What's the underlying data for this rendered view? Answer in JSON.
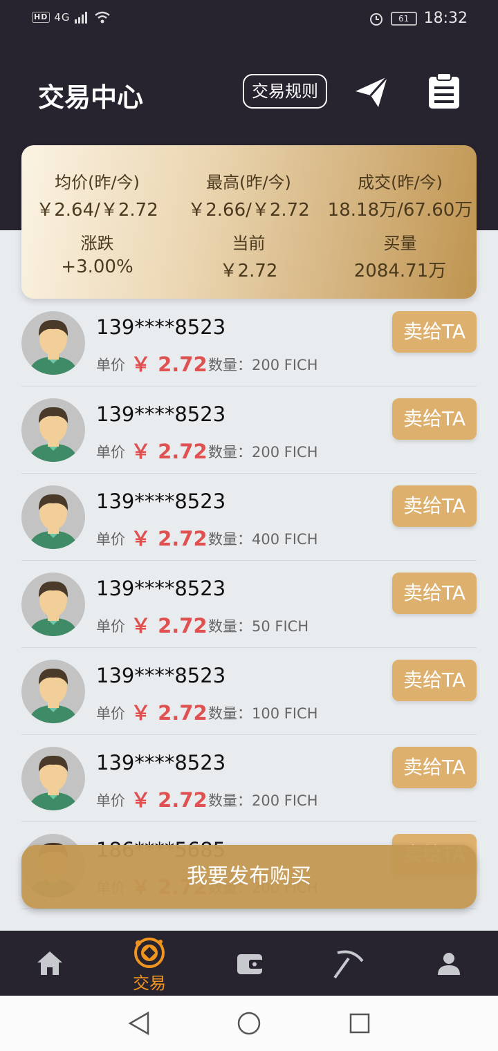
{
  "status_bar": {
    "network": "4G",
    "hd": "HD",
    "battery": "61",
    "time": "18:32"
  },
  "header": {
    "title": "交易中心",
    "rules_label": "交易规则"
  },
  "stats": [
    {
      "label": "均价(昨/今)",
      "value": "￥2.64/￥2.72"
    },
    {
      "label": "最高(昨/今)",
      "value": "￥2.66/￥2.72"
    },
    {
      "label": "成交(昨/今)",
      "value": "18.18万/67.60万"
    },
    {
      "label": "涨跌",
      "value": "+3.00%"
    },
    {
      "label": "当前",
      "value": "￥2.72"
    },
    {
      "label": "买量",
      "value": "2084.71万"
    }
  ],
  "orders": [
    {
      "phone": "139****8523",
      "price_label": "单价",
      "price": "￥ 2.72",
      "quantity": "数量：200 FICH",
      "action": "卖给TA"
    },
    {
      "phone": "139****8523",
      "price_label": "单价",
      "price": "￥ 2.72",
      "quantity": "数量：200 FICH",
      "action": "卖给TA"
    },
    {
      "phone": "139****8523",
      "price_label": "单价",
      "price": "￥ 2.72",
      "quantity": "数量：400 FICH",
      "action": "卖给TA"
    },
    {
      "phone": "139****8523",
      "price_label": "单价",
      "price": "￥ 2.72",
      "quantity": "数量：50 FICH",
      "action": "卖给TA"
    },
    {
      "phone": "139****8523",
      "price_label": "单价",
      "price": "￥ 2.72",
      "quantity": "数量：100 FICH",
      "action": "卖给TA"
    },
    {
      "phone": "139****8523",
      "price_label": "单价",
      "price": "￥ 2.72",
      "quantity": "数量：200 FICH",
      "action": "卖给TA"
    },
    {
      "phone": "186****5685",
      "price_label": "单价",
      "price": "￥ 2.72",
      "quantity": "数量：200 FICH",
      "action": "卖给TA"
    }
  ],
  "publish_button": "我要发布购买",
  "tabs": [
    {
      "icon": "home-icon",
      "label": ""
    },
    {
      "icon": "trade-icon",
      "label": "交易"
    },
    {
      "icon": "wallet-icon",
      "label": ""
    },
    {
      "icon": "pickaxe-icon",
      "label": ""
    },
    {
      "icon": "user-icon",
      "label": ""
    }
  ],
  "colors": {
    "header_bg": "#27232f",
    "accent": "#ddb06d",
    "price": "#e05252",
    "active_tab": "#f0951f"
  }
}
